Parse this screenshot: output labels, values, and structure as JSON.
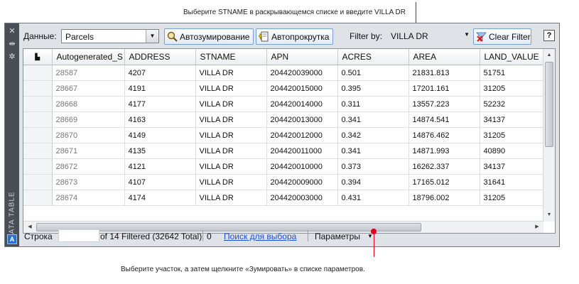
{
  "callouts": {
    "top": "Выберите STNAME в раскрывающемся списке и введите VILLA DR",
    "bottom": "Выберите участок, а затем щелкните «Зумировать» в списке параметров."
  },
  "colors": {
    "callout_accent": "#e0001b",
    "link": "#1b4fd8",
    "palette_frame": "#4a4f57"
  },
  "palette": {
    "title": "DATA TABLE",
    "strip_icons": [
      "close-icon",
      "auto-hide-icon",
      "properties-icon"
    ],
    "logo_letter": "A"
  },
  "toolbar": {
    "data_label": "Данные:",
    "data_value": "Parcels",
    "autozoom_label": "Автозумирование",
    "autoscroll_label": "Автопрокрутка",
    "filter_label": "Filter by:",
    "filter_value": "VILLA DR",
    "clear_filter_label": "Clear Filter",
    "help_label": "?"
  },
  "table": {
    "columns": [
      "Autogenerated_S",
      "ADDRESS",
      "STNAME",
      "APN",
      "ACRES",
      "AREA",
      "LAND_VALUE"
    ],
    "rows": [
      [
        "28587",
        "4207",
        "VILLA DR",
        "204420039000",
        "0.501",
        "21831.813",
        "51751"
      ],
      [
        "28667",
        "4191",
        "VILLA DR",
        "204420015000",
        "0.395",
        "17201.161",
        "31205"
      ],
      [
        "28668",
        "4177",
        "VILLA DR",
        "204420014000",
        "0.311",
        "13557.223",
        "52232"
      ],
      [
        "28669",
        "4163",
        "VILLA DR",
        "204420013000",
        "0.341",
        "14874.541",
        "34137"
      ],
      [
        "28670",
        "4149",
        "VILLA DR",
        "204420012000",
        "0.342",
        "14876.462",
        "31205"
      ],
      [
        "28671",
        "4135",
        "VILLA DR",
        "204420011000",
        "0.341",
        "14871.993",
        "40890"
      ],
      [
        "28672",
        "4121",
        "VILLA DR",
        "204420010000",
        "0.373",
        "16262.337",
        "34137"
      ],
      [
        "28673",
        "4107",
        "VILLA DR",
        "204420009000",
        "0.394",
        "17165.012",
        "31641"
      ],
      [
        "28674",
        "4174",
        "VILLA DR",
        "204420003000",
        "0.431",
        "18796.002",
        "31205"
      ]
    ]
  },
  "status": {
    "row_label": "Строка",
    "filtered_text": "of 14 Filtered (32642 Total)",
    "selected_count": "0",
    "search_link": "Поиск для выбора",
    "options_label": "Параметры"
  }
}
